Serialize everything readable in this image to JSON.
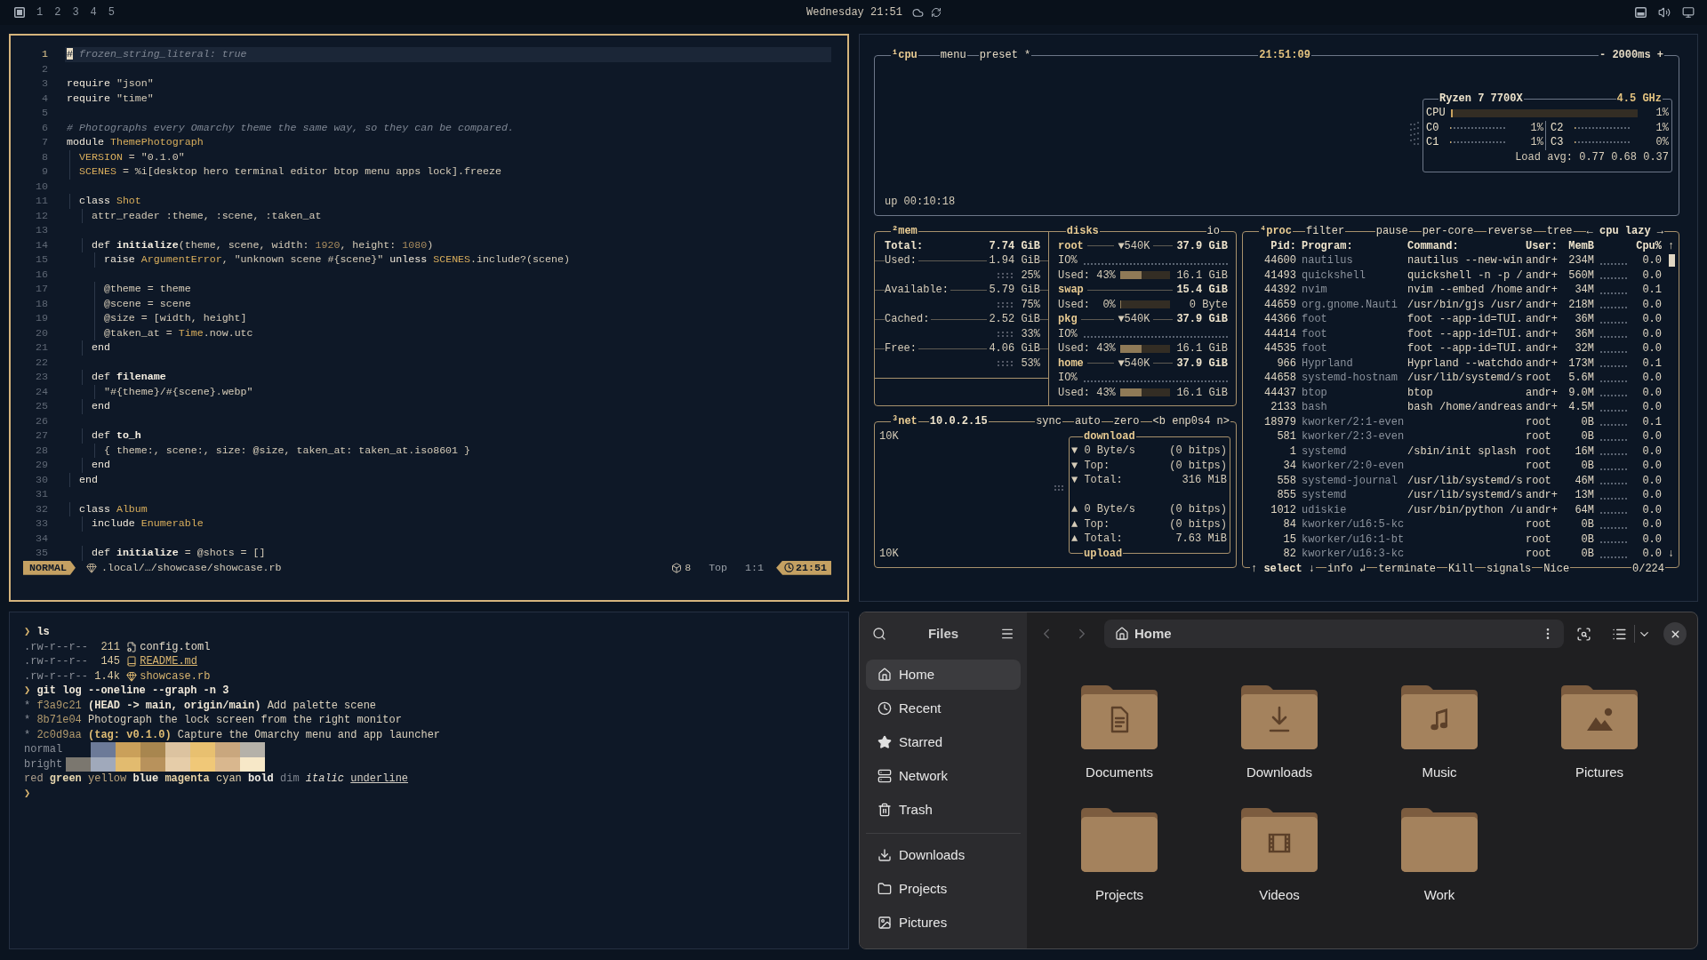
{
  "top_bar": {
    "workspaces": [
      "1",
      "2",
      "3",
      "4",
      "5"
    ],
    "clock": "Wednesday 21:51"
  },
  "editor": {
    "lines": [
      {
        "number": "1",
        "current": true,
        "segments": [
          {
            "kind": "cursor",
            "text": "#"
          },
          {
            "kind": "comment",
            "text": " frozen_string_literal: true"
          }
        ]
      },
      {
        "number": "2",
        "current": false
      },
      {
        "number": "3",
        "current": false,
        "segments": [
          {
            "kind": "keyword",
            "text": "require"
          },
          {
            "kind": "plain",
            "text": " \"json\""
          }
        ]
      },
      {
        "number": "4",
        "current": false,
        "segments": [
          {
            "kind": "keyword",
            "text": "require"
          },
          {
            "kind": "plain",
            "text": " \"time\""
          }
        ]
      },
      {
        "number": "5",
        "current": false
      },
      {
        "number": "6",
        "current": false,
        "segments": [
          {
            "kind": "comment",
            "text": "# Photographs every Omarchy theme the same way, so they can be compared."
          }
        ]
      },
      {
        "number": "7",
        "current": false,
        "segments": [
          {
            "kind": "keyword",
            "text": "module"
          },
          {
            "kind": "constant",
            "text": " ThemePhotograph"
          }
        ]
      },
      {
        "number": "8",
        "current": false,
        "segments": [
          {
            "kind": "constant",
            "text": "  VERSION"
          },
          {
            "kind": "plain",
            "text": " = \"0.1.0\""
          }
        ]
      },
      {
        "number": "9",
        "current": false,
        "segments": [
          {
            "kind": "constant",
            "text": "  SCENES"
          },
          {
            "kind": "plain",
            "text": " = %i[desktop hero terminal editor btop menu apps lock].freeze"
          }
        ]
      },
      {
        "number": "10",
        "current": false
      },
      {
        "number": "11",
        "current": false,
        "segments": [
          {
            "kind": "keyword",
            "text": "  class"
          },
          {
            "kind": "constant",
            "text": " Shot"
          }
        ]
      },
      {
        "number": "12",
        "current": false,
        "segments": [
          {
            "kind": "plain",
            "text": "    attr_reader :theme, :scene, :taken_at"
          }
        ]
      },
      {
        "number": "13",
        "current": false
      },
      {
        "number": "14",
        "current": false,
        "segments": [
          {
            "kind": "keyword",
            "text": "    def"
          },
          {
            "kind": "function",
            "text": " initialize"
          },
          {
            "kind": "plain",
            "text": "(theme, scene, width: "
          },
          {
            "kind": "number",
            "text": "1920"
          },
          {
            "kind": "plain",
            "text": ", height: "
          },
          {
            "kind": "number",
            "text": "1080"
          },
          {
            "kind": "plain",
            "text": ")"
          }
        ]
      },
      {
        "number": "15",
        "current": false,
        "segments": [
          {
            "kind": "keyword",
            "text": "      raise"
          },
          {
            "kind": "constant",
            "text": " ArgumentError"
          },
          {
            "kind": "plain",
            "text": ", \"unknown scene #{scene}\" "
          },
          {
            "kind": "keyword",
            "text": "unless"
          },
          {
            "kind": "constant",
            "text": " SCENES"
          },
          {
            "kind": "plain",
            "text": ".include?(scene)"
          }
        ]
      },
      {
        "number": "16",
        "current": false
      },
      {
        "number": "17",
        "current": false,
        "segments": [
          {
            "kind": "plain",
            "text": "      @theme = theme"
          }
        ]
      },
      {
        "number": "18",
        "current": false,
        "segments": [
          {
            "kind": "plain",
            "text": "      @scene = scene"
          }
        ]
      },
      {
        "number": "19",
        "current": false,
        "segments": [
          {
            "kind": "plain",
            "text": "      @size = [width, height]"
          }
        ]
      },
      {
        "number": "20",
        "current": false,
        "segments": [
          {
            "kind": "plain",
            "text": "      @taken_at = "
          },
          {
            "kind": "constant",
            "text": "Time"
          },
          {
            "kind": "plain",
            "text": ".now.utc"
          }
        ]
      },
      {
        "number": "21",
        "current": false,
        "segments": [
          {
            "kind": "keyword",
            "text": "    end"
          }
        ]
      },
      {
        "number": "22",
        "current": false
      },
      {
        "number": "23",
        "current": false,
        "segments": [
          {
            "kind": "keyword",
            "text": "    def"
          },
          {
            "kind": "function",
            "text": " filename"
          }
        ]
      },
      {
        "number": "24",
        "current": false,
        "segments": [
          {
            "kind": "plain",
            "text": "      \"#{theme}/#{scene}.webp\""
          }
        ]
      },
      {
        "number": "25",
        "current": false,
        "segments": [
          {
            "kind": "keyword",
            "text": "    end"
          }
        ]
      },
      {
        "number": "26",
        "current": false
      },
      {
        "number": "27",
        "current": false,
        "segments": [
          {
            "kind": "keyword",
            "text": "    def"
          },
          {
            "kind": "function",
            "text": " to_h"
          }
        ]
      },
      {
        "number": "28",
        "current": false,
        "segments": [
          {
            "kind": "plain",
            "text": "      { theme:, scene:, size: @size, taken_at: taken_at.iso8601 }"
          }
        ]
      },
      {
        "number": "29",
        "current": false,
        "segments": [
          {
            "kind": "keyword",
            "text": "    end"
          }
        ]
      },
      {
        "number": "30",
        "current": false,
        "segments": [
          {
            "kind": "keyword",
            "text": "  end"
          }
        ]
      },
      {
        "number": "31",
        "current": false
      },
      {
        "number": "32",
        "current": false,
        "segments": [
          {
            "kind": "keyword",
            "text": "  class"
          },
          {
            "kind": "constant",
            "text": " Album"
          }
        ]
      },
      {
        "number": "33",
        "current": false,
        "segments": [
          {
            "kind": "keyword",
            "text": "    include"
          },
          {
            "kind": "constant",
            "text": " Enumerable"
          }
        ]
      },
      {
        "number": "34",
        "current": false
      },
      {
        "number": "35",
        "current": false,
        "segments": [
          {
            "kind": "keyword",
            "text": "    def"
          },
          {
            "kind": "function",
            "text": " initialize"
          },
          {
            "kind": "plain",
            "text": " = @shots = []"
          }
        ]
      }
    ],
    "status": {
      "mode": "NORMAL",
      "path": ".local/…/showcase/showcase.rb",
      "count": "8",
      "position": "Top",
      "cursor": "1:1",
      "time": "21:51"
    }
  },
  "btop": {
    "cpu": {
      "title": "¹cpu",
      "menu": [
        "menu",
        "preset *"
      ],
      "clock": "21:51:09",
      "interval": "- 2000ms +",
      "uptime": "up 00:10:18",
      "model": "Ryzen 7 7700X",
      "frequency": "4.5 GHz",
      "total": {
        "label": "CPU",
        "reading": "1%",
        "level": 0.01
      },
      "cores": [
        {
          "label": "C0",
          "reading": "1%",
          "level": 0.01
        },
        {
          "label": "C2",
          "reading": "1%",
          "level": 0.01
        },
        {
          "label": "C1",
          "reading": "1%",
          "level": 0.01
        },
        {
          "label": "C3",
          "reading": "0%",
          "level": 0
        }
      ],
      "load": "Load avg: 0.77 0.68 0.37"
    },
    "mem": {
      "title": "²mem",
      "total": {
        "label": "Total:",
        "value": "7.74 GiB"
      },
      "stats": [
        {
          "label": "Used:",
          "value": "1.94 GiB",
          "percent": "25%"
        },
        {
          "label": "Available:",
          "value": "5.79 GiB",
          "percent": "75%"
        },
        {
          "label": "Cached:",
          "value": "2.52 GiB",
          "percent": "33%"
        },
        {
          "label": "Free:",
          "value": "4.06 GiB",
          "percent": "53%"
        }
      ]
    },
    "disks": {
      "title": "disks",
      "io_title": "io",
      "items": [
        {
          "name": "root",
          "io": "▼540K",
          "size": "37.9 GiB",
          "io_label": "IO%",
          "used_label": "Used:",
          "used_percent": "43%",
          "level": 0.43,
          "used_size": "16.1 GiB"
        },
        {
          "name": "swap",
          "size": "15.4 GiB",
          "used_label": "Used:",
          "used_percent": "0%",
          "level": 0,
          "used_size": "0 Byte"
        },
        {
          "name": "pkg",
          "io": "▼540K",
          "size": "37.9 GiB",
          "io_label": "IO%",
          "used_label": "Used:",
          "used_percent": "43%",
          "level": 0.43,
          "used_size": "16.1 GiB"
        },
        {
          "name": "home",
          "io": "▼540K",
          "size": "37.9 GiB",
          "io_label": "IO%",
          "used_label": "Used:",
          "used_percent": "43%",
          "level": 0.43,
          "used_size": "16.1 GiB"
        }
      ]
    },
    "net": {
      "title": "³net",
      "address": "10.0.2.15",
      "options": [
        "sync",
        "auto",
        "zero",
        "<b enp0s4 n>"
      ],
      "scale_top": "10K",
      "scale_bottom": "10K",
      "download": {
        "title": "download",
        "rows": [
          {
            "arrow": "▼",
            "label": "0 Byte/s",
            "value": "(0 bitps)"
          },
          {
            "arrow": "▼",
            "label": "Top:",
            "value": "(0 bitps)"
          },
          {
            "arrow": "▼",
            "label": "Total:",
            "value": "316 MiB"
          }
        ]
      },
      "upload": {
        "title": "upload",
        "rows": [
          {
            "arrow": "▲",
            "label": "0 Byte/s",
            "value": "(0 bitps)"
          },
          {
            "arrow": "▲",
            "label": "Top:",
            "value": "(0 bitps)"
          },
          {
            "arrow": "▲",
            "label": "Total:",
            "value": "7.63 MiB"
          }
        ]
      }
    },
    "proc": {
      "title": "⁴proc",
      "filter": "filter",
      "options": [
        "pause",
        "per-core",
        "reverse",
        "tree"
      ],
      "sort": "← cpu lazy →",
      "columns": [
        "Pid:",
        "Program:",
        "Command:",
        "User:",
        "MemB",
        "Cpu%"
      ],
      "scroll_up": "↑",
      "scroll_down": "↓",
      "rows": [
        {
          "pid": "44600",
          "program": "nautilus",
          "command": "nautilus --new-win",
          "user": "andr+",
          "mem": "234M",
          "cpu": "0.0"
        },
        {
          "pid": "41493",
          "program": "quickshell",
          "command": "quickshell -n -p /",
          "user": "andr+",
          "mem": "560M",
          "cpu": "0.0"
        },
        {
          "pid": "44392",
          "program": "nvim",
          "command": "nvim --embed /home",
          "user": "andr+",
          "mem": "34M",
          "cpu": "0.1"
        },
        {
          "pid": "44659",
          "program": "org.gnome.Nauti",
          "command": "/usr/bin/gjs /usr/",
          "user": "andr+",
          "mem": "218M",
          "cpu": "0.0"
        },
        {
          "pid": "44366",
          "program": "foot",
          "command": "foot --app-id=TUI.",
          "user": "andr+",
          "mem": "36M",
          "cpu": "0.0"
        },
        {
          "pid": "44414",
          "program": "foot",
          "command": "foot --app-id=TUI.",
          "user": "andr+",
          "mem": "36M",
          "cpu": "0.0"
        },
        {
          "pid": "44535",
          "program": "foot",
          "command": "foot --app-id=TUI.",
          "user": "andr+",
          "mem": "32M",
          "cpu": "0.0"
        },
        {
          "pid": "966",
          "program": "Hyprland",
          "command": "Hyprland --watchdo",
          "user": "andr+",
          "mem": "173M",
          "cpu": "0.1"
        },
        {
          "pid": "44658",
          "program": "systemd-hostnam",
          "command": "/usr/lib/systemd/s",
          "user": "root",
          "mem": "5.6M",
          "cpu": "0.0"
        },
        {
          "pid": "44437",
          "program": "btop",
          "command": "btop",
          "user": "andr+",
          "mem": "9.0M",
          "cpu": "0.0"
        },
        {
          "pid": "2133",
          "program": "bash",
          "command": "bash /home/andreas",
          "user": "andr+",
          "mem": "4.5M",
          "cpu": "0.0"
        },
        {
          "pid": "18979",
          "program": "kworker/2:1-even",
          "user": "root",
          "mem": "0B",
          "cpu": "0.1"
        },
        {
          "pid": "581",
          "program": "kworker/2:3-even",
          "user": "root",
          "mem": "0B",
          "cpu": "0.0"
        },
        {
          "pid": "1",
          "program": "systemd",
          "command": "/sbin/init splash",
          "user": "root",
          "mem": "16M",
          "cpu": "0.0"
        },
        {
          "pid": "34",
          "program": "kworker/2:0-even",
          "user": "root",
          "mem": "0B",
          "cpu": "0.0"
        },
        {
          "pid": "558",
          "program": "systemd-journal",
          "command": "/usr/lib/systemd/s",
          "user": "root",
          "mem": "46M",
          "cpu": "0.0"
        },
        {
          "pid": "855",
          "program": "systemd",
          "command": "/usr/lib/systemd/s",
          "user": "andr+",
          "mem": "13M",
          "cpu": "0.0"
        },
        {
          "pid": "1012",
          "program": "udiskie",
          "command": "/usr/bin/python /u",
          "user": "andr+",
          "mem": "64M",
          "cpu": "0.0"
        },
        {
          "pid": "84",
          "program": "kworker/u16:5-kc",
          "user": "root",
          "mem": "0B",
          "cpu": "0.0"
        },
        {
          "pid": "15",
          "program": "kworker/u16:1-bt",
          "user": "root",
          "mem": "0B",
          "cpu": "0.0"
        },
        {
          "pid": "82",
          "program": "kworker/u16:3-kc",
          "user": "root",
          "mem": "0B",
          "cpu": "0.0"
        }
      ],
      "footer": [
        "↑ select ↓",
        "info ↲",
        "terminate",
        "Kill",
        "signals",
        "Nice"
      ],
      "count": "0/224"
    }
  },
  "terminal": {
    "lines": [
      {
        "kind": "prompt",
        "symbol": "❯",
        "command": "ls"
      },
      {
        "kind": "file",
        "permissions": ".rw-r--r--",
        "size": "211",
        "name": {
          "text": "config.toml",
          "kind": "config"
        }
      },
      {
        "kind": "file",
        "permissions": ".rw-r--r--",
        "size": "145",
        "name": {
          "text": "README.md",
          "kind": "readme"
        }
      },
      {
        "kind": "file",
        "permissions": ".rw-r--r--",
        "size": "1.4k",
        "name": {
          "text": "showcase.rb",
          "kind": "source"
        }
      },
      {
        "kind": "prompt",
        "symbol": "❯",
        "command": "git log --oneline --graph -n 3"
      },
      {
        "kind": "commit",
        "graph": "*",
        "hash": "f3a9c21",
        "refs": {
          "text": "(HEAD -> main, origin/main)",
          "kind": "branch"
        },
        "message": "Add palette scene"
      },
      {
        "kind": "commit",
        "graph": "*",
        "hash": "8b71e04",
        "message": "Photograph the lock screen from the right monitor"
      },
      {
        "kind": "commit",
        "graph": "*",
        "hash": "2c0d9aa",
        "refs": {
          "text": "(tag: v0.1.0)",
          "kind": "tag"
        },
        "message": "Capture the Omarchy menu and app launcher"
      },
      {
        "kind": "palette",
        "label": "normal",
        "swatches": [
          {
            "color": "#6c7a98"
          },
          {
            "color": "#caa05a"
          },
          {
            "color": "#a8864f"
          },
          {
            "color": "#dcc3a0"
          },
          {
            "color": "#e8c070"
          },
          {
            "color": "#c9a77e"
          },
          {
            "color": "#b5b1a9"
          }
        ]
      },
      {
        "kind": "palette",
        "label": "bright",
        "swatches": [
          {
            "color": "#7b776f"
          },
          {
            "color": "#a0a9bb"
          },
          {
            "color": "#e2bb6f"
          },
          {
            "color": "#b8925c"
          },
          {
            "color": "#e6cda9"
          },
          {
            "color": "#f0c878"
          },
          {
            "color": "#d9b78e"
          },
          {
            "color": "#f7e8c8"
          }
        ]
      },
      {
        "kind": "styles",
        "words": [
          {
            "text": "red",
            "kind": "plain",
            "color": "#ac9e8c"
          },
          {
            "text": "green",
            "kind": "bold",
            "color": "#e8d8b0"
          },
          {
            "text": "yellow",
            "kind": "plain",
            "color": "#bba37c"
          },
          {
            "text": "blue",
            "kind": "bold",
            "color": "#f2ead9"
          },
          {
            "text": "magenta",
            "kind": "bold",
            "color": "#e9d3a6"
          },
          {
            "text": "cyan",
            "kind": "plain",
            "color": "#dccbaa"
          },
          {
            "text": "bold",
            "kind": "bold",
            "color": "#f2eee6"
          },
          {
            "text": "dim",
            "kind": "plain",
            "color": "#7f8590"
          },
          {
            "text": "italic",
            "kind": "italic",
            "color": "#e4ddd0"
          },
          {
            "text": "underline",
            "kind": "underline",
            "color": "#d5cfc4"
          }
        ]
      },
      {
        "kind": "prompt",
        "symbol": "❯"
      }
    ]
  },
  "files": {
    "title": "Files",
    "places": [
      {
        "label": "Home",
        "kind": "home",
        "selected": true
      },
      {
        "label": "Recent",
        "kind": "recent",
        "selected": false
      },
      {
        "label": "Starred",
        "kind": "starred",
        "selected": false
      },
      {
        "label": "Network",
        "kind": "network",
        "selected": false
      },
      {
        "label": "Trash",
        "kind": "trash",
        "selected": false
      }
    ],
    "bookmarks": [
      {
        "label": "Downloads",
        "kind": "downloads",
        "selected": false
      },
      {
        "label": "Projects",
        "kind": "folder",
        "selected": false
      },
      {
        "label": "Pictures",
        "kind": "pictures",
        "selected": false
      }
    ],
    "back": {
      "disabled": true
    },
    "forward": {
      "disabled": true
    },
    "location": "Home",
    "folders": [
      {
        "label": "Documents",
        "kind": "documents"
      },
      {
        "label": "Downloads",
        "kind": "downloads"
      },
      {
        "label": "Music",
        "kind": "music"
      },
      {
        "label": "Pictures",
        "kind": "pictures"
      },
      {
        "label": "Projects",
        "kind": "plain"
      },
      {
        "label": "Videos",
        "kind": "videos"
      },
      {
        "label": "Work",
        "kind": "plain"
      }
    ]
  }
}
